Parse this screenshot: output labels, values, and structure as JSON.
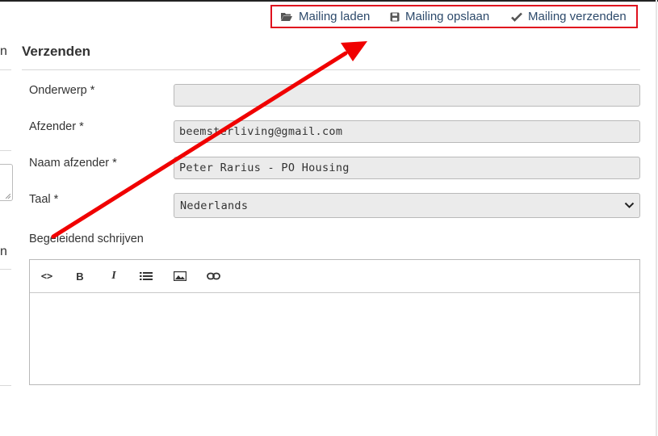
{
  "toolbar": {
    "load_label": "Mailing laden",
    "save_label": "Mailing opslaan",
    "send_label": "Mailing verzenden"
  },
  "left_panel": {
    "frag_1": "n",
    "frag_2": "n"
  },
  "section": {
    "title": "Verzenden"
  },
  "form": {
    "subject_label": "Onderwerp *",
    "subject_value": "",
    "sender_label": "Afzender *",
    "sender_value": "beemsterliving@gmail.com",
    "sender_name_label": "Naam afzender *",
    "sender_name_value": "Peter Rarius - PO Housing",
    "language_label": "Taal *",
    "language_value": "Nederlands",
    "letter_label": "Begeleidend schrijven"
  },
  "editor_toolbar": {
    "code": "<>",
    "bold": "B",
    "italic": "I"
  },
  "colors": {
    "highlight_border": "#e0111e",
    "arrow": "#f00000",
    "link_text": "#2d4a6b"
  }
}
